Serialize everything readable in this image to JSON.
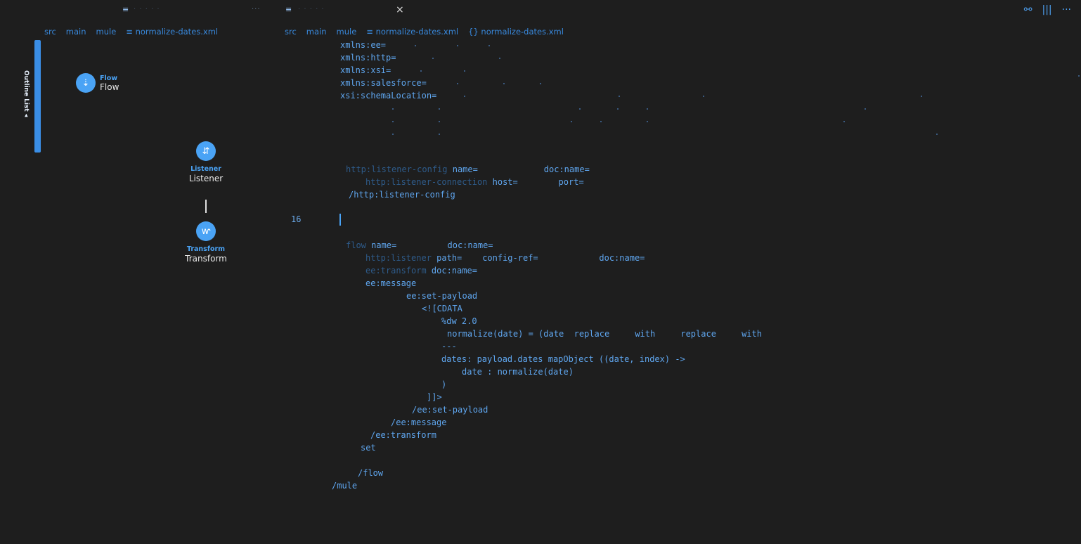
{
  "tabs": {
    "tab1_icon": "≡",
    "tab2_icon": "≡",
    "close_glyph": "×",
    "more_glyph": "···"
  },
  "toolbar": {
    "icons": [
      "diagram-icon",
      "columns-icon",
      "more-icon"
    ],
    "columns_glyph": "|||",
    "more_glyph": "···",
    "diagram_glyph": "⚯"
  },
  "breadcrumb_left": [
    "src",
    "main",
    "mule",
    "≡ normalize-dates.xml"
  ],
  "breadcrumb_right": [
    "src",
    "main",
    "mule",
    "≡ normalize-dates.xml",
    "{} normalize-dates.xml"
  ],
  "outline": {
    "label": "Outline List ◂"
  },
  "canvas": {
    "flow": {
      "type": "Flow",
      "name": "Flow"
    },
    "listener": {
      "type": "Listener",
      "name": "Listener"
    },
    "transform": {
      "type": "Transform",
      "name": "Transform"
    }
  },
  "editor": {
    "current_line": "16",
    "lines": {
      "l1": "xmlns:ee=",
      "l2": "xmlns:http=",
      "l3": "xmlns:xsi=",
      "l4": "xmlns:salesforce=",
      "l5": "xsi:schemaLocation=",
      "l6a": "name=",
      "l6b": "doc:name=",
      "l7a": "host=",
      "l7b": "port=",
      "l8a": "name=",
      "l8b": "doc:name=",
      "l9a": "path=",
      "l9b": "config-ref=",
      "l9c": "doc:name=",
      "l10": "doc:name=",
      "l11": "<![CDATA",
      "l12a": "normalize(date) = (date",
      "l12b": "replace",
      "l12c": "with",
      "l12d": "replace",
      "l12e": "with",
      "l13": "---",
      "l14": "dates: payload.dates mapObject ((date, index) ->",
      "l15": "date : normalize(date)",
      "l16": "]]>",
      "l17": "set"
    }
  }
}
